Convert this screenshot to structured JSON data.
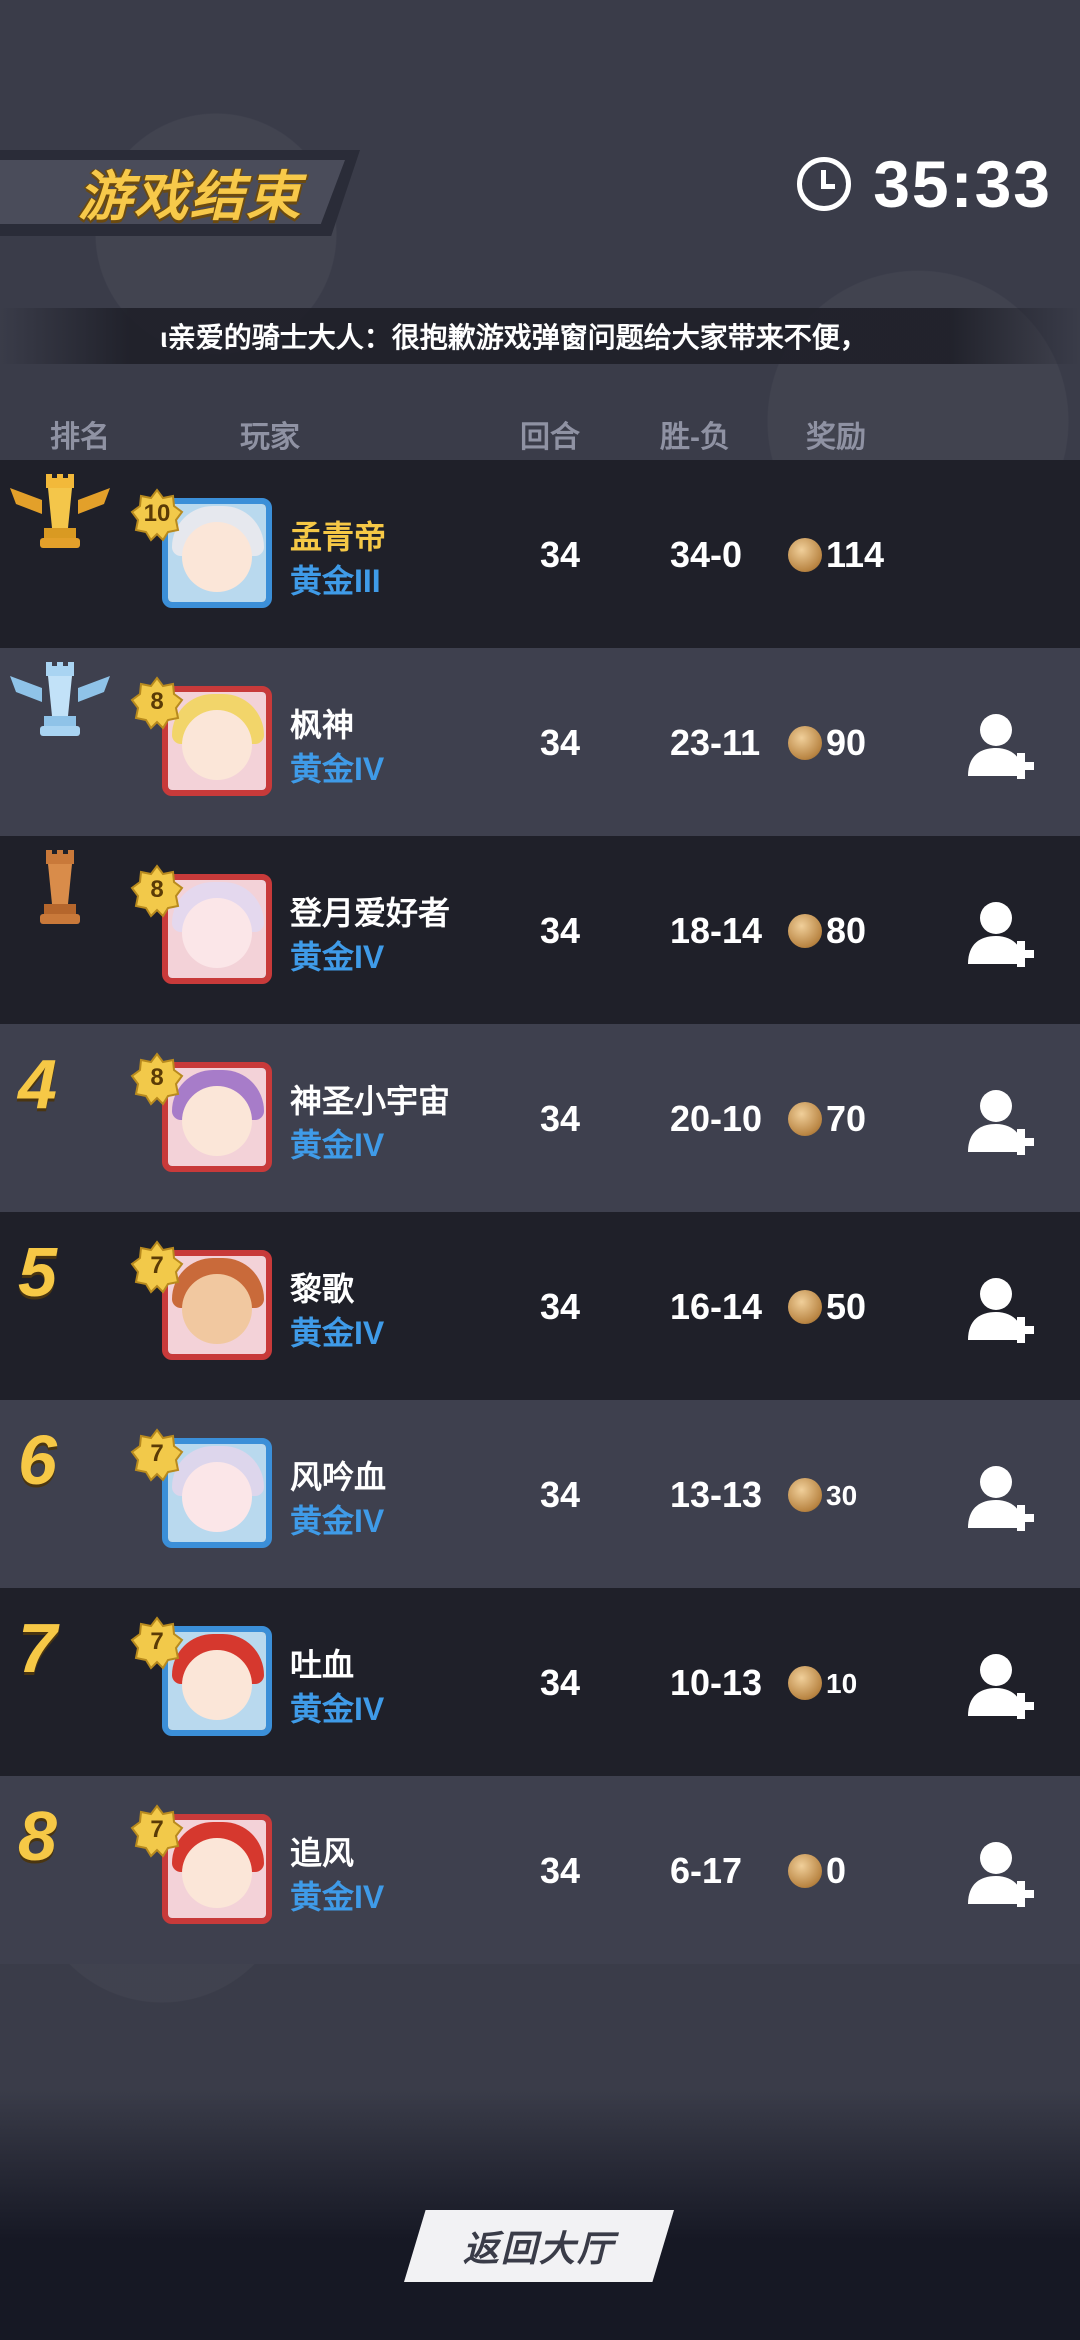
{
  "header": {
    "title": "游戏结束",
    "timer": "35:33"
  },
  "notice": {
    "text": "ι亲爱的骑士大人：很抱歉游戏弹窗问题给大家带来不便，"
  },
  "columns": {
    "rank": "排名",
    "player": "玩家",
    "rounds": "回合",
    "win_loss": "胜-负",
    "reward": "奖励"
  },
  "players": [
    {
      "rank": "1",
      "level": "10",
      "name": "孟青帝",
      "tier": "黄金III",
      "rounds": "34",
      "win_loss": "34-0",
      "reward": "114"
    },
    {
      "rank": "2",
      "level": "8",
      "name": "枫神",
      "tier": "黄金IV",
      "rounds": "34",
      "win_loss": "23-11",
      "reward": "90"
    },
    {
      "rank": "3",
      "level": "8",
      "name": "登月爱好者",
      "tier": "黄金IV",
      "rounds": "34",
      "win_loss": "18-14",
      "reward": "80"
    },
    {
      "rank": "4",
      "level": "8",
      "name": "神圣小宇宙",
      "tier": "黄金IV",
      "rounds": "34",
      "win_loss": "20-10",
      "reward": "70"
    },
    {
      "rank": "5",
      "level": "7",
      "name": "黎歌",
      "tier": "黄金IV",
      "rounds": "34",
      "win_loss": "16-14",
      "reward": "50"
    },
    {
      "rank": "6",
      "level": "7",
      "name": "风吟血",
      "tier": "黄金IV",
      "rounds": "34",
      "win_loss": "13-13",
      "reward": "30"
    },
    {
      "rank": "7",
      "level": "7",
      "name": "吐血",
      "tier": "黄金IV",
      "rounds": "34",
      "win_loss": "10-13",
      "reward": "10"
    },
    {
      "rank": "8",
      "level": "7",
      "name": "追风",
      "tier": "黄金IV",
      "rounds": "34",
      "win_loss": "6-17",
      "reward": "0"
    }
  ],
  "footer": {
    "back_button": "返回大厅"
  },
  "colors": {
    "gold": "#f6c846",
    "tier_blue": "#3f9be8",
    "row_dark": "#1f2029",
    "row_light": "#3e404e"
  }
}
